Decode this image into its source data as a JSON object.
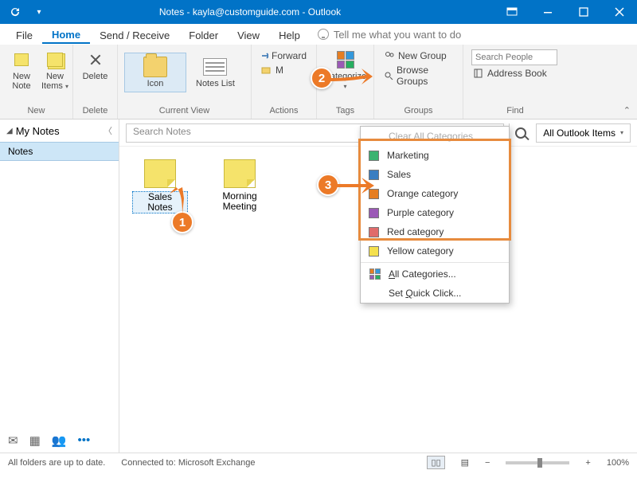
{
  "titlebar": {
    "title": "Notes - kayla@customguide.com - Outlook"
  },
  "menu": {
    "file": "File",
    "home": "Home",
    "sendrecv": "Send / Receive",
    "folder": "Folder",
    "view": "View",
    "help": "Help",
    "tellme": "Tell me what you want to do"
  },
  "ribbon": {
    "new": {
      "label": "New",
      "newnote": "New\nNote",
      "newitems": "New\nItems"
    },
    "delete": {
      "label": "Delete",
      "delete": "Delete"
    },
    "currentview": {
      "label": "Current View",
      "icon": "Icon",
      "noteslist": "Notes List"
    },
    "actions": {
      "label": "Actions",
      "forward": "Forward",
      "move": "M"
    },
    "tags": {
      "label": "Tags",
      "categorize": "Categorize"
    },
    "groups": {
      "label": "Groups",
      "newgroup": "New Group",
      "browse": "Browse Groups"
    },
    "find": {
      "label": "Find",
      "placeholder": "Search People",
      "addressbook": "Address Book"
    }
  },
  "folderpane": {
    "header": "My Notes",
    "item1": "Notes"
  },
  "search": {
    "placeholder": "Search Notes",
    "scope": "All Outlook Items"
  },
  "notes": [
    {
      "name": "Sales Notes",
      "selected": true
    },
    {
      "name": "Morning\nMeeting",
      "selected": false
    }
  ],
  "dropdown": {
    "clear": "Clear All Categories",
    "items": [
      {
        "label": "Marketing",
        "color": "#3cb371"
      },
      {
        "label": "Sales",
        "color": "#3a7ec1"
      },
      {
        "label": "Orange category",
        "color": "#e67e22"
      },
      {
        "label": "Purple category",
        "color": "#9b59b6"
      },
      {
        "label": "Red category",
        "color": "#e06b6b"
      },
      {
        "label": "Yellow category",
        "color": "#f4e04d"
      }
    ],
    "all": "All Categories...",
    "quick": "Set Quick Click..."
  },
  "status": {
    "folders": "All folders are up to date.",
    "connected": "Connected to: Microsoft Exchange",
    "zoom": "100%"
  },
  "callouts": {
    "one": "1",
    "two": "2",
    "three": "3"
  }
}
